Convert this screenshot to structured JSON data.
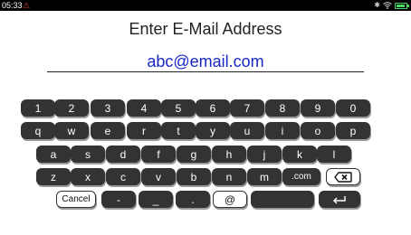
{
  "status": {
    "time": "05:33",
    "alert_glyph": "⚠"
  },
  "title": "Enter E-Mail Address",
  "email": {
    "value": "abc@email.com"
  },
  "keyboard": {
    "row1": [
      "1",
      "2",
      "3",
      "4",
      "5",
      "6",
      "7",
      "8",
      "9",
      "0"
    ],
    "row2": [
      "q",
      "w",
      "e",
      "r",
      "t",
      "y",
      "u",
      "i",
      "o",
      "p"
    ],
    "row3": [
      "a",
      "s",
      "d",
      "f",
      "g",
      "h",
      "j",
      "k",
      "l"
    ],
    "row4": [
      "z",
      "x",
      "c",
      "v",
      "b",
      "n",
      "m"
    ],
    "dotcom": ".com",
    "cancel": "Cancel",
    "dash": "-",
    "underscore": "_",
    "dot": ".",
    "at": "@",
    "space": "",
    "icons": {
      "backspace": "backspace-icon",
      "enter": "enter-icon"
    }
  },
  "colors": {
    "email_text": "#1a28c8",
    "key_bg": "#333333",
    "status_bar": "#000000",
    "battery": "#4cd964",
    "alert": "#e04040"
  }
}
